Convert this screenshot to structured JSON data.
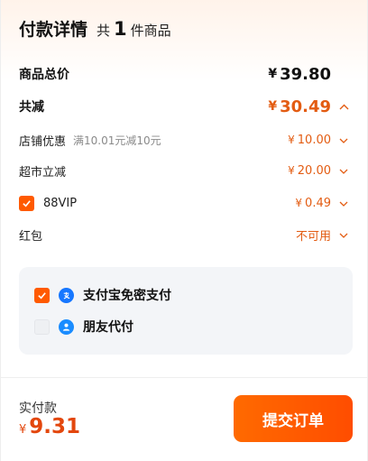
{
  "header": {
    "title": "付款详情",
    "count_prefix": "共",
    "count": "1",
    "count_suffix": "件商品"
  },
  "total": {
    "label": "商品总价",
    "currency": "¥",
    "amount": "39.80"
  },
  "discount": {
    "label": "共减",
    "currency": "¥",
    "amount": "30.49"
  },
  "shop_coupon": {
    "label": "店铺优惠",
    "note": "满10.01元减10元",
    "currency": "¥",
    "amount": "10.00"
  },
  "market_discount": {
    "label": "超市立减",
    "currency": "¥",
    "amount": "20.00"
  },
  "vip": {
    "label": "88VIP",
    "checked": true,
    "currency": "¥",
    "amount": "0.49"
  },
  "red_packet": {
    "label": "红包",
    "status": "不可用"
  },
  "payment_methods": [
    {
      "label": "支付宝免密支付",
      "checked": true,
      "icon": "alipay-icon"
    },
    {
      "label": "朋友代付",
      "checked": false,
      "icon": "friend-pay-icon"
    }
  ],
  "footer": {
    "label": "实付款",
    "currency": "¥",
    "amount": "9.31",
    "submit_label": "提交订单"
  },
  "colors": {
    "accent": "#ff5a00",
    "price": "#e35c12",
    "alipay_blue": "#1677ff",
    "friend_blue": "#1a8cff"
  }
}
